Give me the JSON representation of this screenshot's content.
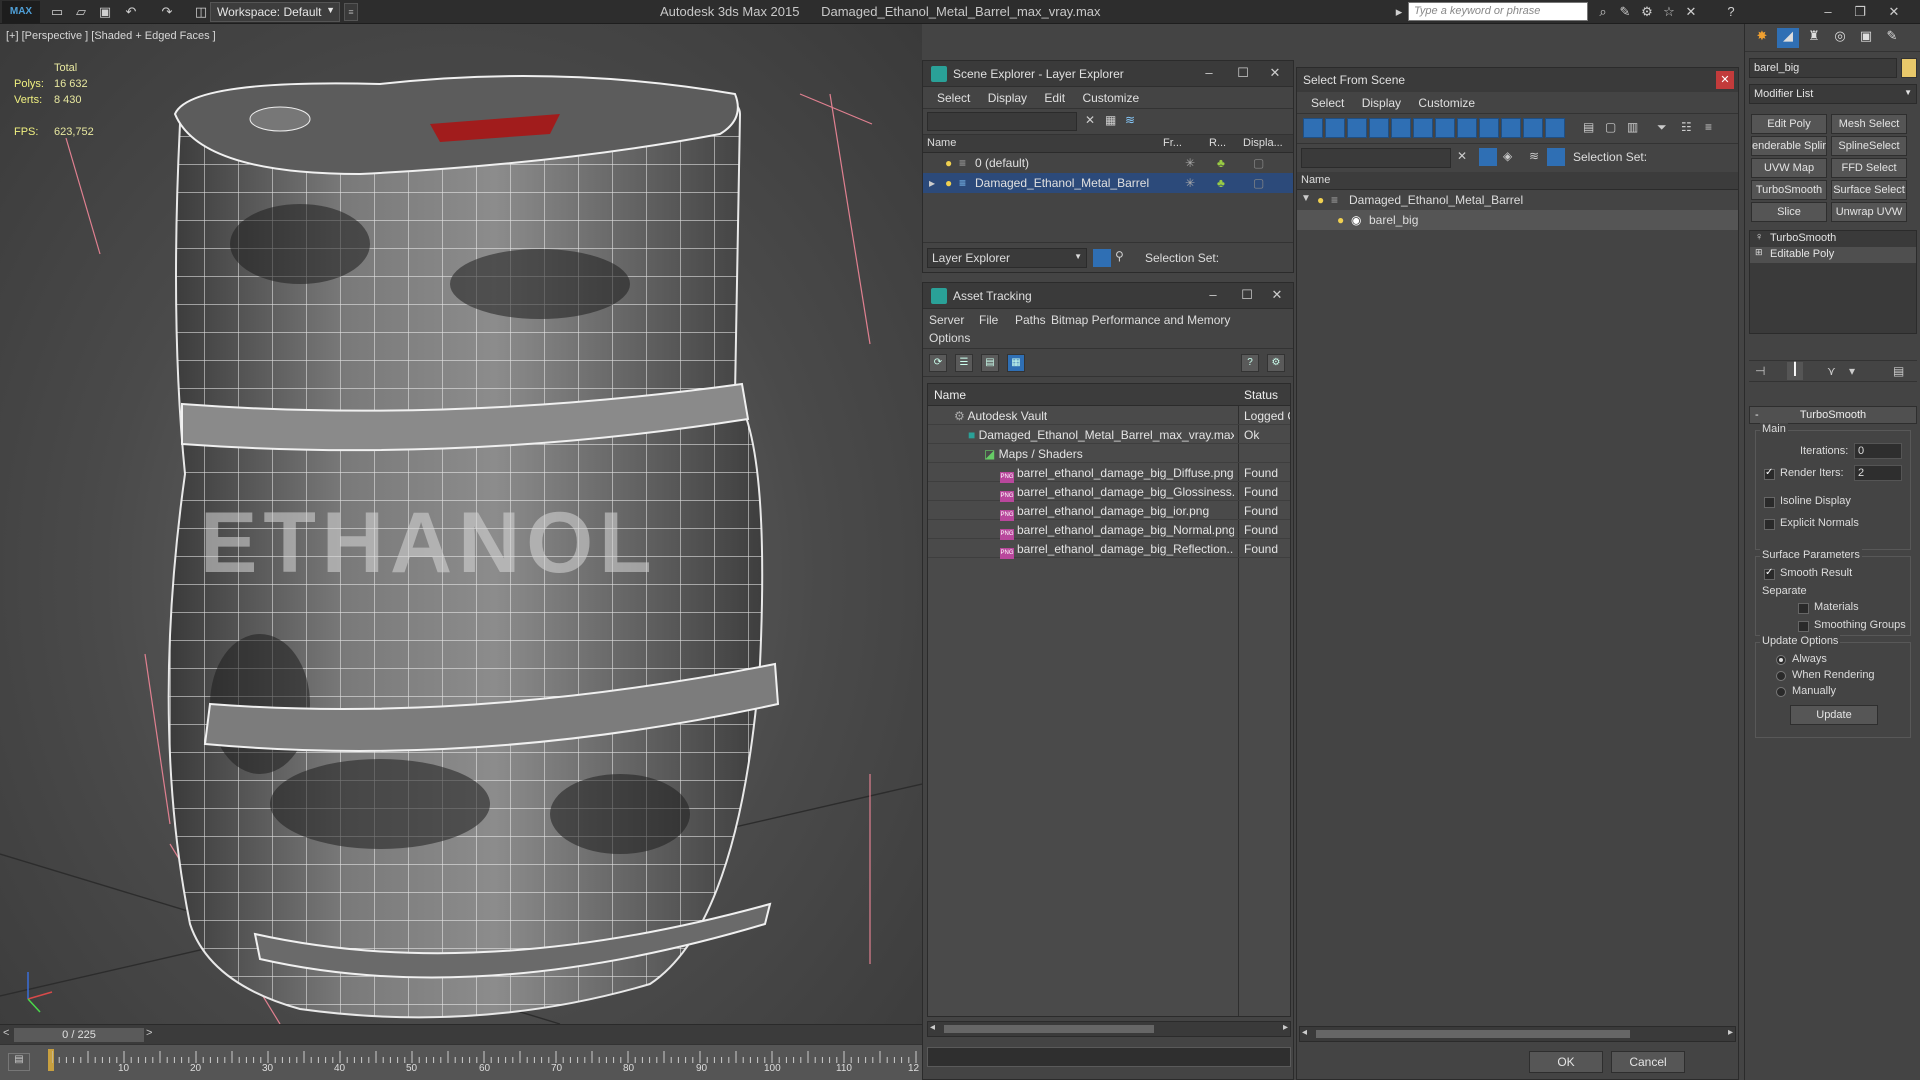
{
  "titlebar": {
    "logo": "MAX",
    "workspace": "Workspace: Default",
    "app_name": "Autodesk 3ds Max  2015",
    "file_name": "Damaged_Ethanol_Metal_Barrel_max_vray.max",
    "search_placeholder": "Type a keyword or phrase"
  },
  "viewport": {
    "label": "[+] [Perspective ] [Shaded + Edged Faces ]",
    "stats": {
      "total_label": "Total",
      "polys_label": "Polys:",
      "polys": "16 632",
      "verts_label": "Verts:",
      "verts": "8 430",
      "fps_label": "FPS:",
      "fps": "623,752"
    },
    "barrel_text": "ETHANOL"
  },
  "timeline": {
    "frame_counter": "0 / 225",
    "ticks": [
      "10",
      "20",
      "30",
      "40",
      "50",
      "60",
      "70",
      "80",
      "90",
      "100",
      "110",
      "12"
    ]
  },
  "scene_explorer": {
    "title": "Scene Explorer - Layer Explorer",
    "menu": [
      "Select",
      "Display",
      "Edit",
      "Customize"
    ],
    "columns": [
      "Name",
      "Fr...",
      "R...",
      "Displa..."
    ],
    "rows": [
      {
        "name": "0 (default)"
      },
      {
        "name": "Damaged_Ethanol_Metal_Barrel"
      }
    ],
    "footer_dropdown": "Layer Explorer",
    "selection_set_label": "Selection Set:"
  },
  "asset_tracking": {
    "title": "Asset Tracking",
    "menu": [
      "Server",
      "File",
      "Paths",
      "Bitmap Performance and Memory",
      "Options"
    ],
    "columns": {
      "name": "Name",
      "status": "Status"
    },
    "rows": [
      {
        "name": "Autodesk Vault",
        "status": "Logged C"
      },
      {
        "name": "Damaged_Ethanol_Metal_Barrel_max_vray.max",
        "status": "Ok"
      },
      {
        "name": "Maps / Shaders",
        "status": ""
      },
      {
        "name": "barrel_ethanol_damage_big_Diffuse.png",
        "status": "Found"
      },
      {
        "name": "barrel_ethanol_damage_big_Glossiness....",
        "status": "Found"
      },
      {
        "name": "barrel_ethanol_damage_big_ior.png",
        "status": "Found"
      },
      {
        "name": "barrel_ethanol_damage_big_Normal.png",
        "status": "Found"
      },
      {
        "name": "barrel_ethanol_damage_big_Reflection....",
        "status": "Found"
      }
    ],
    "file_icon": "PNG"
  },
  "select_from_scene": {
    "title": "Select From Scene",
    "menu": [
      "Select",
      "Display",
      "Customize"
    ],
    "selection_set_label": "Selection Set:",
    "column": "Name",
    "rows": [
      {
        "name": "Damaged_Ethanol_Metal_Barrel"
      },
      {
        "name": "barel_big"
      }
    ],
    "ok": "OK",
    "cancel": "Cancel"
  },
  "command_panel": {
    "object_name": "barel_big",
    "object_color": "#e8c86a",
    "modifier_list": "Modifier List",
    "modifier_buttons": [
      "Edit Poly",
      "Mesh Select",
      "enderable Splir",
      "SplineSelect",
      "UVW Map",
      "FFD Select",
      "TurboSmooth",
      "Surface Select",
      "Slice",
      "Unwrap UVW"
    ],
    "stack": [
      "TurboSmooth",
      "Editable Poly"
    ],
    "rollout": {
      "title": "TurboSmooth",
      "main_label": "Main",
      "iterations_label": "Iterations:",
      "iterations": "0",
      "render_iters_label": "Render Iters:",
      "render_iters": "2",
      "isoline_display": "Isoline Display",
      "explicit_normals": "Explicit Normals",
      "surface_params_label": "Surface Parameters",
      "smooth_result": "Smooth Result",
      "separate_label": "Separate",
      "materials": "Materials",
      "smoothing_groups": "Smoothing Groups",
      "update_options_label": "Update Options",
      "always": "Always",
      "when_rendering": "When Rendering",
      "manually": "Manually",
      "update_button": "Update"
    }
  }
}
